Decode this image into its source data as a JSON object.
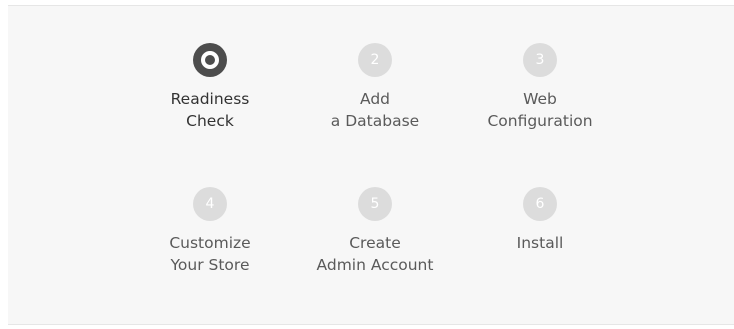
{
  "steps": [
    {
      "number": "",
      "state": "active",
      "line1": "Readiness",
      "line2": "Check"
    },
    {
      "number": "2",
      "state": "pending",
      "line1": "Add",
      "line2": "a Database"
    },
    {
      "number": "3",
      "state": "pending",
      "line1": "Web",
      "line2": "Configuration"
    },
    {
      "number": "4",
      "state": "pending",
      "line1": "Customize",
      "line2": "Your Store"
    },
    {
      "number": "5",
      "state": "pending",
      "line1": "Create",
      "line2": "Admin Account"
    },
    {
      "number": "6",
      "state": "pending",
      "line1": "Install",
      "line2": ""
    }
  ],
  "colors": {
    "panel_background": "#f7f7f7",
    "active_circle": "#4d4d4d",
    "pending_circle": "#dcdcdc",
    "active_text": "#333333",
    "pending_text": "#5a5a5a"
  }
}
